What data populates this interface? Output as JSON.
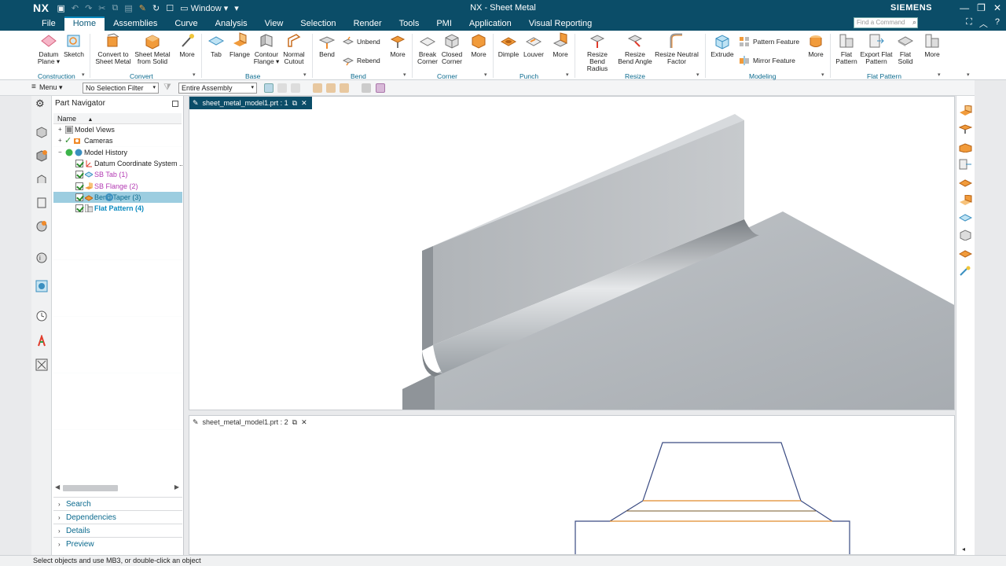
{
  "titlebar": {
    "logo": "NX",
    "window_menu": "Window",
    "title": "NX - Sheet Metal",
    "brand": "SIEMENS"
  },
  "menu_tabs": [
    "File",
    "Home",
    "Assemblies",
    "Curve",
    "Analysis",
    "View",
    "Selection",
    "Render",
    "Tools",
    "PMI",
    "Application",
    "Visual Reporting"
  ],
  "active_tab": "Home",
  "find_command_placeholder": "Find a Command",
  "ribbon": {
    "construction": {
      "label": "Construction",
      "datum_plane": "Datum Plane ▾",
      "sketch": "Sketch"
    },
    "convert": {
      "label": "Convert",
      "convert_to_sheet_metal": "Convert to Sheet Metal",
      "sheet_metal_from_solid": "Sheet Metal from Solid",
      "more": "More"
    },
    "base": {
      "label": "Base",
      "tab": "Tab",
      "flange": "Flange",
      "contour_flange": "Contour Flange ▾",
      "normal_cutout": "Normal Cutout"
    },
    "bend": {
      "label": "Bend",
      "bend": "Bend",
      "unbend": "Unbend",
      "rebend": "Rebend",
      "more": "More"
    },
    "corner": {
      "label": "Corner",
      "break_corner": "Break Corner",
      "closed_corner": "Closed Corner",
      "more": "More"
    },
    "punch": {
      "label": "Punch",
      "dimple": "Dimple",
      "louver": "Louver",
      "more": "More"
    },
    "resize": {
      "label": "Resize",
      "resize_bend_radius": "Resize Bend Radius",
      "resize_bend_angle": "Resize Bend Angle",
      "resize_neutral_factor": "Resize Neutral Factor"
    },
    "modeling": {
      "label": "Modeling",
      "extrude": "Extrude",
      "pattern_feature": "Pattern Feature",
      "mirror_feature": "Mirror Feature",
      "more": "More"
    },
    "flat_pattern": {
      "label": "Flat Pattern",
      "flat_pattern": "Flat Pattern",
      "export_flat_pattern": "Export Flat Pattern",
      "flat_solid": "Flat Solid",
      "more": "More"
    }
  },
  "toolbar": {
    "menu": "Menu ▾",
    "selection_filter": "No Selection Filter",
    "scope": "Entire Assembly"
  },
  "navigator": {
    "title": "Part Navigator",
    "column_name": "Name",
    "items": [
      {
        "label": "Model Views",
        "color": "#222222"
      },
      {
        "label": "Cameras",
        "color": "#222222"
      },
      {
        "label": "Model History",
        "color": "#222222"
      },
      {
        "label": "Datum Coordinate System ...",
        "color": "#222222"
      },
      {
        "label": "SB Tab (1)",
        "color": "#b33ab3"
      },
      {
        "label": "SB Flange (2)",
        "color": "#b33ab3"
      },
      {
        "label": "Bend Taper (3)",
        "color": "#0b6a8e"
      },
      {
        "label": "Flat Pattern (4)",
        "color": "#0b8abf"
      }
    ],
    "sections": [
      "Search",
      "Dependencies",
      "Details",
      "Preview"
    ]
  },
  "graphics": {
    "window1_tab": "sheet_metal_model1.prt : 1",
    "window2_tab": "sheet_metal_model1.prt : 2"
  },
  "status": "Select objects and use MB3, or double-click an object"
}
